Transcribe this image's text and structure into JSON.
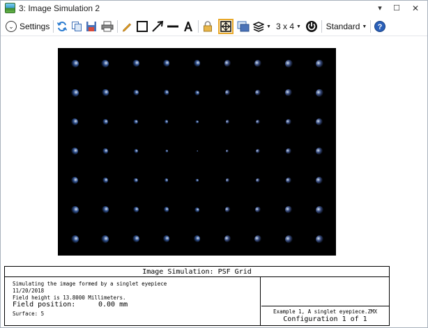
{
  "window": {
    "title": "3: Image Simulation 2",
    "controls": {
      "minimize": "▾",
      "maximize": "☐",
      "close": "✕"
    }
  },
  "toolbar": {
    "settings_label": "Settings",
    "grid_label": "3 x 4",
    "standard_label": "Standard",
    "icons": [
      "refresh-icon",
      "copy-icon",
      "save-icon",
      "print-icon",
      "pencil-icon",
      "rectangle-icon",
      "arrow-icon",
      "line-icon",
      "text-icon",
      "lock-icon",
      "fit-icon",
      "window-icon",
      "layers-icon",
      "power-icon",
      "help-icon"
    ],
    "accent_color": "#e8a82a"
  },
  "image": {
    "grid_rows": 7,
    "grid_cols": 9,
    "background": "#000000"
  },
  "infobox": {
    "title": "Image Simulation: PSF Grid",
    "lines": [
      "Simulating the image formed by a singlet eyepiece",
      "11/20/2018",
      "Field height is 13.8000 Millimeters."
    ],
    "field_position_label": "Field position:",
    "field_position_value": "0.00 mm",
    "surface": "Surface: 5",
    "file": "Example 1, A singlet eyepiece.ZMX",
    "configuration": "Configuration 1 of 1"
  }
}
